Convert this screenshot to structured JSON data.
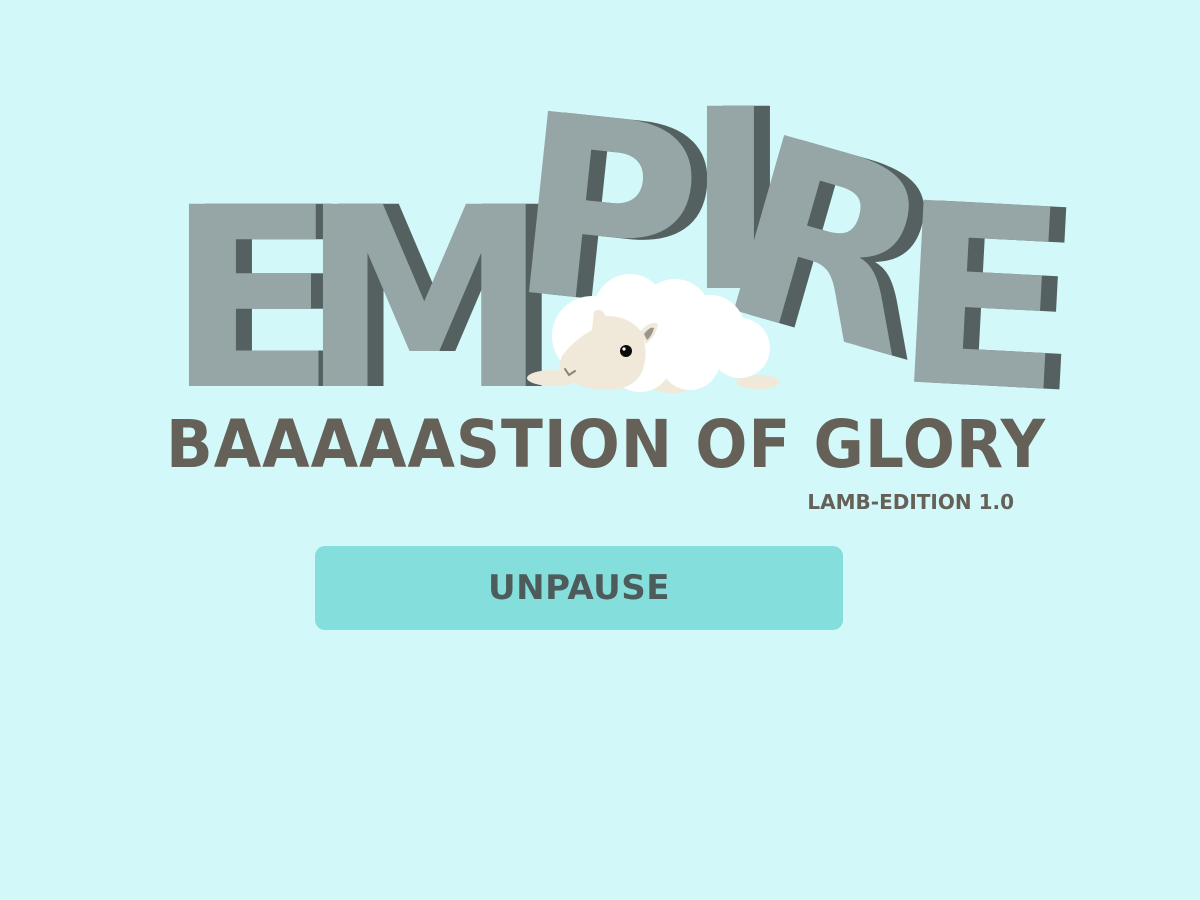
{
  "title": {
    "letters": [
      "E",
      "M",
      "P",
      "I",
      "R",
      "E"
    ]
  },
  "subtitle": "BAAAAASTION OF GLORY",
  "edition": "LAMB-EDITION 1.0",
  "menu": {
    "unpause_label": "UNPAUSE"
  },
  "colors": {
    "background": "#d2f8f9",
    "title_face": "#96a5a6",
    "title_shadow": "#546160",
    "text_dark": "#666158",
    "button": "#84dedc",
    "button_text": "#4d5b5a",
    "sheep_wool": "#ffffff",
    "sheep_face": "#f0e9d9"
  },
  "icons": {
    "mascot": "sheep-icon"
  }
}
